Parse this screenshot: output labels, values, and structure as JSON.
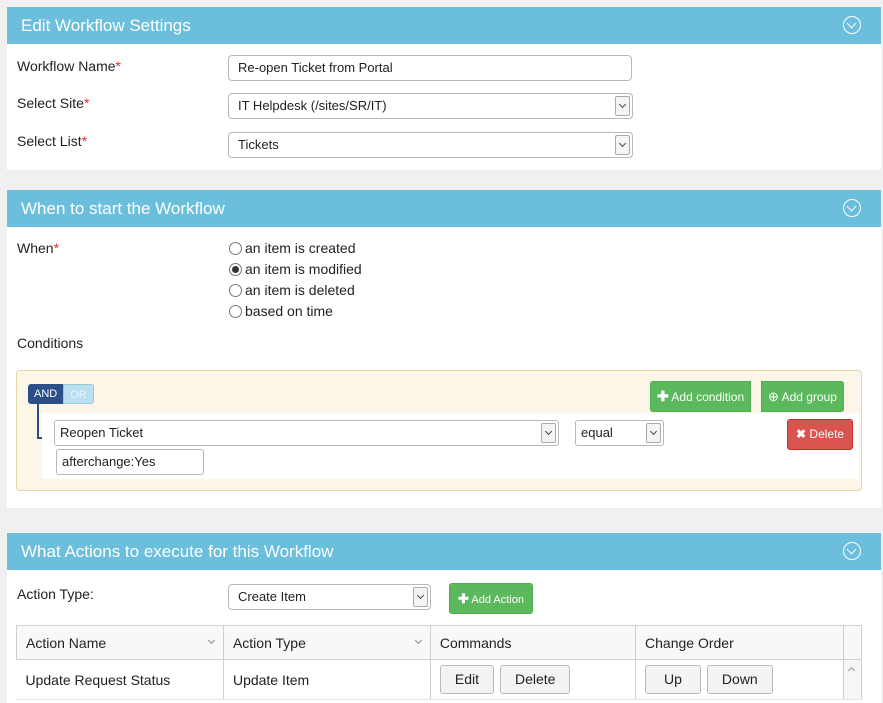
{
  "settings_panel": {
    "title": "Edit Workflow Settings",
    "workflow_name_label": "Workflow Name",
    "workflow_name_value": "Re-open Ticket from Portal",
    "site_label": "Select Site",
    "site_value": "IT Helpdesk (/sites/SR/IT)",
    "list_label": "Select List",
    "list_value": "Tickets",
    "required_marker": "*"
  },
  "start_panel": {
    "title": "When to start the Workflow",
    "when_label": "When",
    "options": [
      {
        "label": "an item is created",
        "checked": false
      },
      {
        "label": "an item is modified",
        "checked": true
      },
      {
        "label": "an item is deleted",
        "checked": false
      },
      {
        "label": "based on time",
        "checked": false
      }
    ],
    "conditions_label": "Conditions",
    "toggle_and": "AND",
    "toggle_or": "OR",
    "add_condition_label": "Add condition",
    "add_group_label": "Add group",
    "delete_label": "Delete",
    "rule": {
      "field": "Reopen Ticket",
      "operator": "equal",
      "value": "afterchange:Yes"
    }
  },
  "actions_panel": {
    "title": "What Actions to execute for this Workflow",
    "action_type_label": "Action Type:",
    "action_type_value": "Create Item",
    "add_action_label": "Add Action",
    "columns": [
      "Action Name",
      "Action Type",
      "Commands",
      "Change Order"
    ],
    "rows": [
      {
        "action_name": "Update Request Status",
        "action_type": "Update Item",
        "edit_label": "Edit",
        "delete_label": "Delete",
        "up_label": "Up",
        "down_label": "Down"
      }
    ]
  },
  "colors": {
    "header": "#6bbfdc",
    "green": "#5cb85c",
    "red": "#d9534f",
    "and_toggle": "#2c4f8a",
    "required": "#d9302c"
  }
}
